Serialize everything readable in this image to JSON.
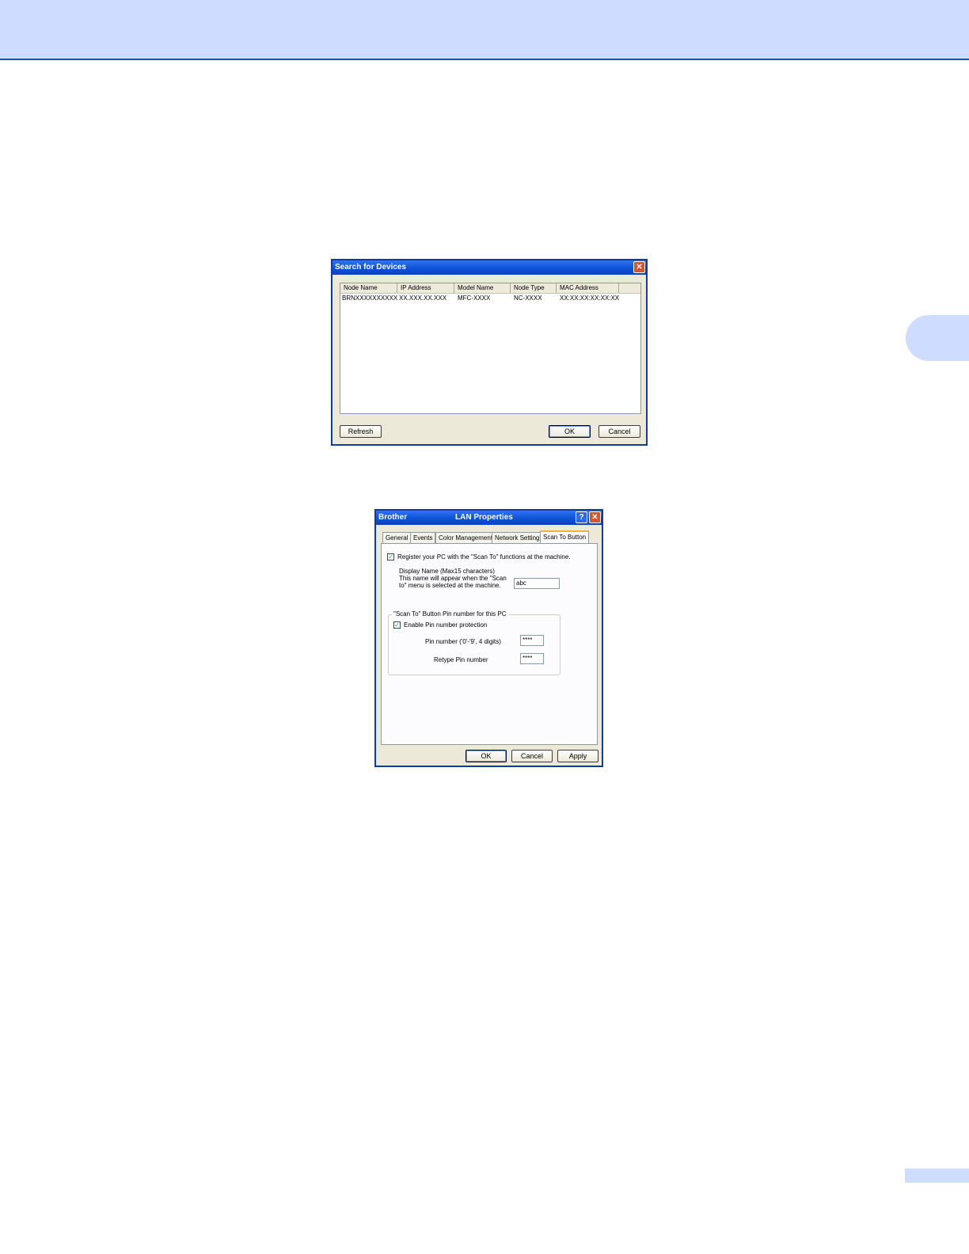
{
  "search_dialog": {
    "title": "Search for Devices",
    "columns": [
      "Node Name",
      "IP Address",
      "Model Name",
      "Node Type",
      "MAC Address"
    ],
    "rows": [
      [
        "BRNXXXXXXXXXXXX",
        "XX.XXX.XX.XXX",
        "MFC-XXXX",
        "NC-XXXX",
        "XX:XX:XX:XX:XX:XX"
      ]
    ],
    "buttons": {
      "refresh": "Refresh",
      "ok": "OK",
      "cancel": "Cancel"
    }
  },
  "lan_dialog": {
    "title_left": "Brother",
    "title_right": "LAN Properties",
    "tabs": [
      "General",
      "Events",
      "Color Management",
      "Network Setting",
      "Scan To Button"
    ],
    "active_tab": "Scan To Button",
    "register_checkbox_label": "Register your PC with the \"Scan To\" functions at the machine.",
    "register_checked": true,
    "display_name_text_1": "Display Name (Max15 characters)",
    "display_name_text_2": "This name will appear when the \"Scan",
    "display_name_text_3": "to\" menu is selected at the machine.",
    "display_name_value": "abc",
    "pin_group_title": "\"Scan To\" Button Pin number for this PC",
    "enable_pin_label": "Enable Pin number protection",
    "enable_pin_checked": true,
    "pin_number_label": "Pin number ('0'-'9', 4 digits)",
    "pin_number_value": "****",
    "retype_pin_label": "Retype Pin number",
    "retype_pin_value": "****",
    "buttons": {
      "ok": "OK",
      "cancel": "Cancel",
      "apply": "Apply"
    }
  }
}
